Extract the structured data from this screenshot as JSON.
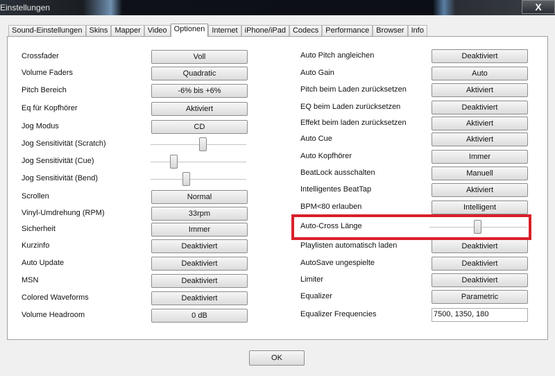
{
  "window": {
    "title": "Einstellungen",
    "close_label": "X"
  },
  "tabs": [
    "Sound-Einstellungen",
    "Skins",
    "Mapper",
    "Video",
    "Optionen",
    "Internet",
    "iPhone/iPad",
    "Codecs",
    "Performance",
    "Browser",
    "Info"
  ],
  "active_tab": "Optionen",
  "left": [
    {
      "label": "Crossfader",
      "type": "button",
      "value": "Voll"
    },
    {
      "label": "Volume Faders",
      "type": "button",
      "value": "Quadratic"
    },
    {
      "label": "Pitch Bereich",
      "type": "button",
      "value": "-6% bis +6%"
    },
    {
      "label": "Eq für Kopfhörer",
      "type": "button",
      "value": "Aktiviert"
    },
    {
      "label": "Jog Modus",
      "type": "button",
      "value": "CD"
    },
    {
      "label": "Jog Sensitivität (Scratch)",
      "type": "slider",
      "level": 0.55
    },
    {
      "label": "Jog Sensitivität (Cue)",
      "type": "slider",
      "level": 0.22
    },
    {
      "label": "Jog Sensitivität (Bend)",
      "type": "slider",
      "level": 0.36
    },
    {
      "label": "Scrollen",
      "type": "button",
      "value": "Normal"
    },
    {
      "label": "Vinyl-Umdrehung (RPM)",
      "type": "button",
      "value": "33rpm"
    },
    {
      "label": "Sicherheit",
      "type": "button",
      "value": "Immer"
    },
    {
      "label": "Kurzinfo",
      "type": "button",
      "value": "Deaktiviert"
    },
    {
      "label": "Auto Update",
      "type": "button",
      "value": "Deaktiviert"
    },
    {
      "label": "MSN",
      "type": "button",
      "value": "Deaktiviert"
    },
    {
      "label": "Colored Waveforms",
      "type": "button",
      "value": "Deaktiviert"
    },
    {
      "label": "Volume Headroom",
      "type": "button",
      "value": "0 dB"
    }
  ],
  "right": [
    {
      "label": "Auto Pitch angleichen",
      "type": "button",
      "value": "Deaktiviert"
    },
    {
      "label": "Auto Gain",
      "type": "button",
      "value": "Auto"
    },
    {
      "label": "Pitch beim Laden zurücksetzen",
      "type": "button",
      "value": "Aktiviert"
    },
    {
      "label": "EQ beim Laden zurücksetzen",
      "type": "button",
      "value": "Deaktiviert"
    },
    {
      "label": "Effekt beim laden zurücksetzen",
      "type": "button",
      "value": "Aktiviert"
    },
    {
      "label": "Auto Cue",
      "type": "button",
      "value": "Aktiviert"
    },
    {
      "label": "Auto Kopfhörer",
      "type": "button",
      "value": "Immer"
    },
    {
      "label": "BeatLock ausschalten",
      "type": "button",
      "value": "Manuell"
    },
    {
      "label": "Intelligentes BeatTap",
      "type": "button",
      "value": "Aktiviert"
    },
    {
      "label": "BPM<80 erlauben",
      "type": "button",
      "value": "Intelligent"
    },
    {
      "label": "Auto-Cross Länge",
      "type": "slider",
      "level": 0.49
    },
    {
      "label": "Playlisten automatisch laden",
      "type": "button",
      "value": "Deaktiviert"
    },
    {
      "label": "AutoSave ungespielte",
      "type": "button",
      "value": "Deaktiviert"
    },
    {
      "label": "Limiter",
      "type": "button",
      "value": "Deaktiviert"
    },
    {
      "label": "Equalizer",
      "type": "button",
      "value": "Parametric"
    },
    {
      "label": "Equalizer Frequencies",
      "type": "field",
      "value": "7500, 1350, 180"
    }
  ],
  "ok_label": "OK",
  "highlight_color": "#d9202a"
}
